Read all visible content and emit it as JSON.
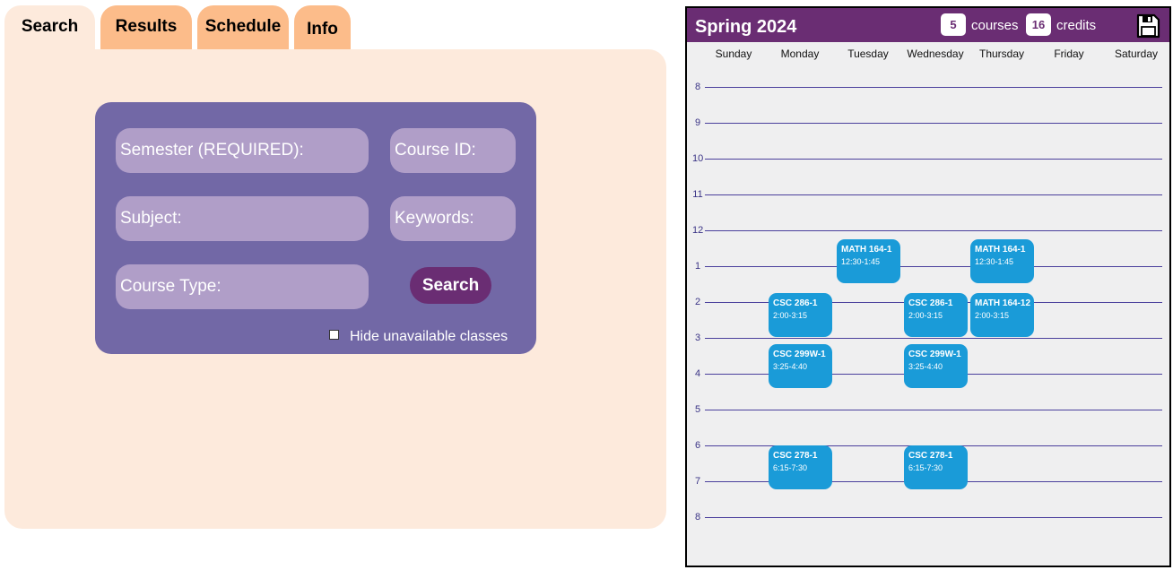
{
  "tabs": [
    {
      "label": "Search",
      "active": true
    },
    {
      "label": "Results",
      "active": false
    },
    {
      "label": "Schedule",
      "active": false
    },
    {
      "label": "Info",
      "active": false
    }
  ],
  "search_form": {
    "semester_placeholder": "Semester (REQUIRED):",
    "course_id_placeholder": "Course ID:",
    "subject_placeholder": "Subject:",
    "keywords_placeholder": "Keywords:",
    "course_type_placeholder": "Course Type:",
    "search_button_label": "Search",
    "hide_unavailable_label": "Hide unavailable classes",
    "hide_unavailable_checked": false
  },
  "calendar": {
    "semester_title": "Spring 2024",
    "courses_count": "5",
    "courses_label": "courses",
    "credits_count": "16",
    "credits_label": "credits",
    "save_icon": "floppy-disk-icon",
    "days": [
      "Sunday",
      "Monday",
      "Tuesday",
      "Wednesday",
      "Thursday",
      "Friday",
      "Saturday"
    ],
    "hours": [
      "8",
      "9",
      "10",
      "11",
      "12",
      "1",
      "2",
      "3",
      "4",
      "5",
      "6",
      "7",
      "8"
    ],
    "events": [
      {
        "code": "MATH 164-1",
        "time": "12:30-1:45",
        "day": "Tuesday"
      },
      {
        "code": "MATH 164-1",
        "time": "12:30-1:45",
        "day": "Thursday"
      },
      {
        "code": "CSC 286-1",
        "time": "2:00-3:15",
        "day": "Monday"
      },
      {
        "code": "CSC 286-1",
        "time": "2:00-3:15",
        "day": "Wednesday"
      },
      {
        "code": "MATH 164-12",
        "time": "2:00-3:15",
        "day": "Thursday"
      },
      {
        "code": "CSC 299W-1",
        "time": "3:25-4:40",
        "day": "Monday"
      },
      {
        "code": "CSC 299W-1",
        "time": "3:25-4:40",
        "day": "Wednesday"
      },
      {
        "code": "CSC 278-1",
        "time": "6:15-7:30",
        "day": "Monday"
      },
      {
        "code": "CSC 278-1",
        "time": "6:15-7:30",
        "day": "Wednesday"
      }
    ],
    "event_color": "#1a9bd8",
    "header_color": "#6a2d73"
  }
}
